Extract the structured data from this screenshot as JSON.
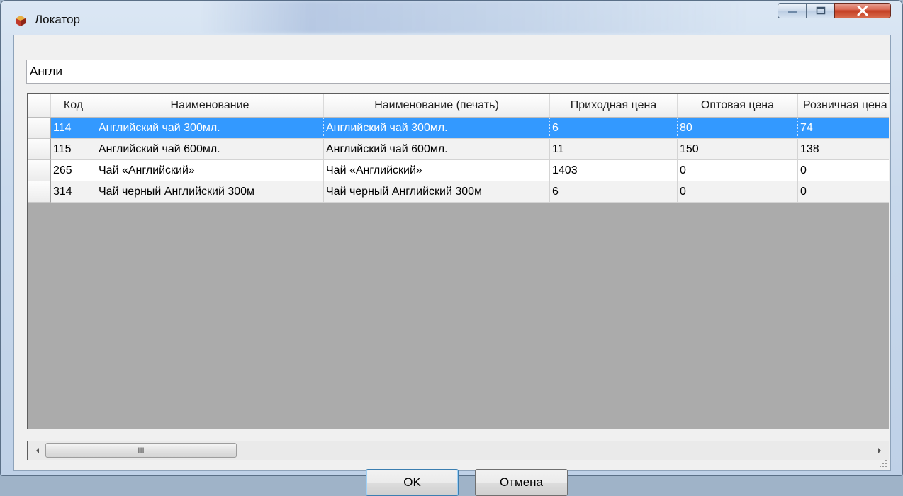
{
  "window": {
    "title": "Локатор"
  },
  "search": {
    "value": "Англи"
  },
  "grid": {
    "columns": [
      "Код",
      "Наименование",
      "Наименование (печать)",
      "Приходная цена",
      "Оптовая цена",
      "Розничная цена"
    ],
    "rows": [
      {
        "code": "114",
        "name": "Английский чай 300мл.",
        "print_name": "Английский чай 300мл.",
        "in_price": "6",
        "wholesale": "80",
        "retail": "74",
        "selected": true
      },
      {
        "code": "115",
        "name": "Английский чай 600мл.",
        "print_name": "Английский чай 600мл.",
        "in_price": "11",
        "wholesale": "150",
        "retail": "138",
        "selected": false
      },
      {
        "code": "265",
        "name": "Чай «Английский»",
        "print_name": "Чай «Английский»",
        "in_price": "1403",
        "wholesale": "0",
        "retail": "0",
        "selected": false
      },
      {
        "code": "314",
        "name": "Чай черный Английский 300м",
        "print_name": "Чай черный Английский 300м",
        "in_price": "6",
        "wholesale": "0",
        "retail": "0",
        "selected": false
      }
    ]
  },
  "scrollbar": {
    "thumb_grip": "III"
  },
  "buttons": {
    "ok": "OK",
    "cancel": "Отмена"
  },
  "colors": {
    "selection": "#3399ff",
    "grid_background": "#ababab"
  },
  "icons": [
    "app-icon",
    "minimize-icon",
    "maximize-icon",
    "close-icon",
    "scroll-left-icon",
    "scroll-right-icon",
    "resize-grip-icon"
  ]
}
